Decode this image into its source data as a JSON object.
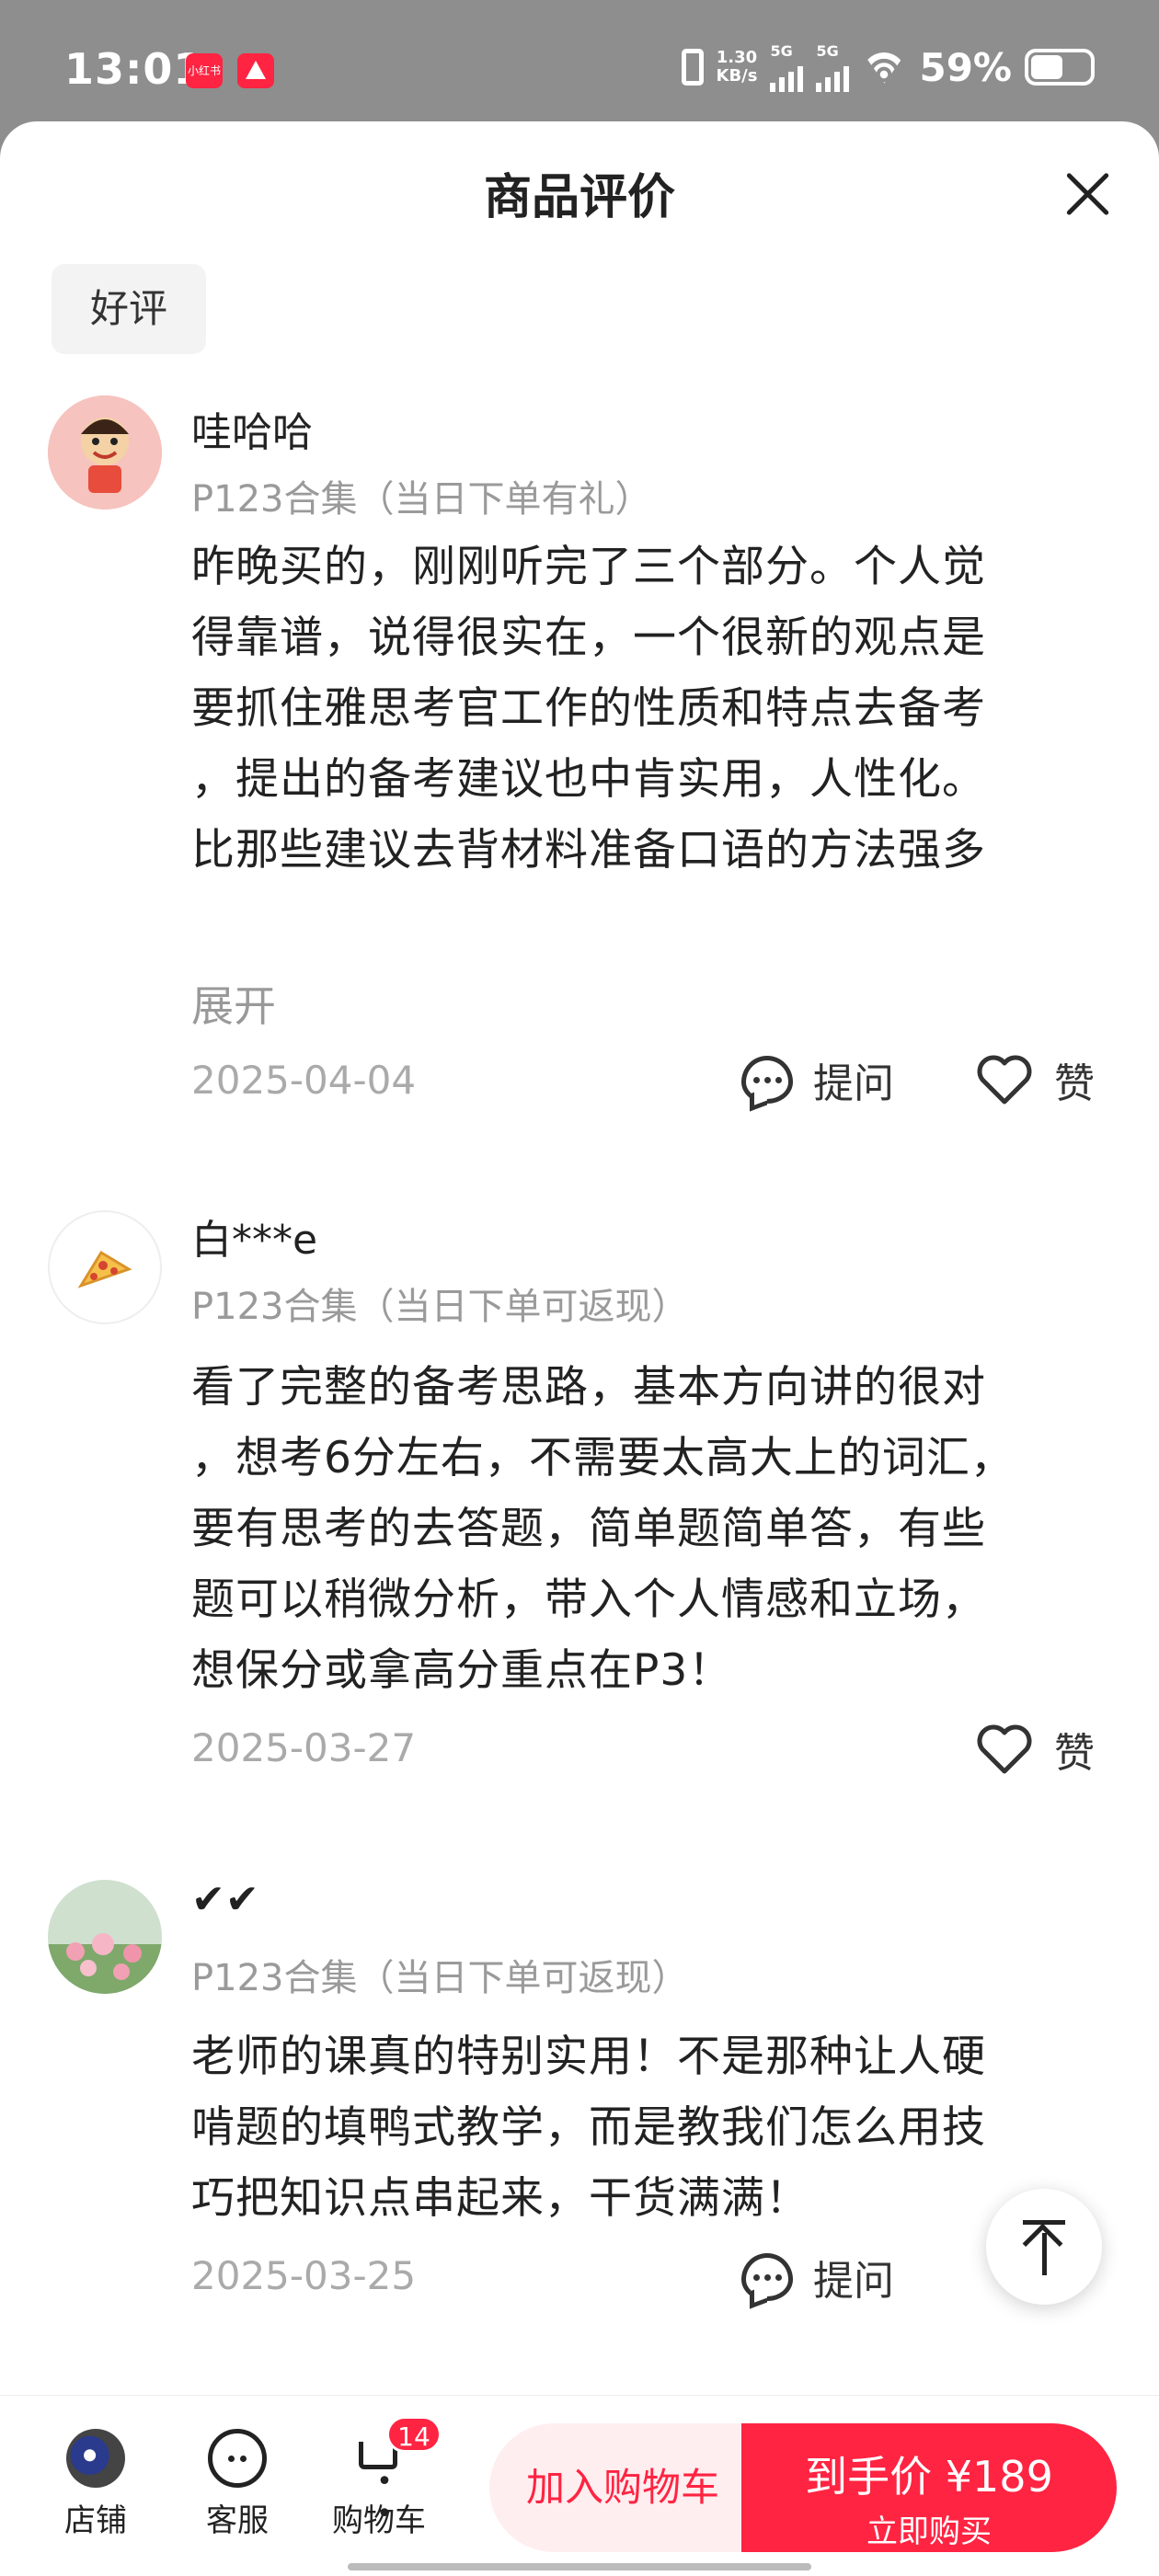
{
  "status_bar": {
    "time": "13:01",
    "app_badge_1": "小红书",
    "net_speed_top": "1.30",
    "net_speed_bottom": "KB/s",
    "sig1": "5G",
    "sig2": "5G",
    "battery": "59%"
  },
  "sheet": {
    "title": "商品评价",
    "filter_chip": "好评"
  },
  "reviews": [
    {
      "user": "哇哈哈",
      "variant": "P123合集（当日下单有礼）",
      "lines": [
        "昨晚买的，刚刚听完了三个部分。个人觉",
        "得靠谱，说得很实在，一个很新的观点是",
        "要抓住雅思考官工作的性质和特点去备考",
        "，提出的备考建议也中肯实用，人性化。",
        "比那些建议去背材料准备口语的方法强多"
      ],
      "expand": "展开",
      "date": "2025-04-04",
      "ask": "提问",
      "like": "赞"
    },
    {
      "user": "白***e",
      "variant": "P123合集（当日下单可返现）",
      "lines": [
        "看了完整的备考思路，基本方向讲的很对",
        "，想考6分左右，不需要太高大上的词汇，",
        "要有思考的去答题，简单题简单答，有些",
        "题可以稍微分析，带入个人情感和立场，",
        "想保分或拿高分重点在P3！"
      ],
      "date": "2025-03-27",
      "like": "赞"
    },
    {
      "user": "✔✔",
      "variant": "P123合集（当日下单可返现）",
      "lines": [
        "老师的课真的特别实用！不是那种让人硬",
        "啃题的填鸭式教学，而是教我们怎么用技",
        "巧把知识点串起来，干货满满！"
      ],
      "date": "2025-03-25",
      "ask": "提问"
    }
  ],
  "bottom_bar": {
    "store": "店铺",
    "service": "客服",
    "cart": "购物车",
    "cart_count": "14",
    "add_cart": "加入购物车",
    "price": "到手价 ¥189",
    "buy_now": "立即购买"
  },
  "colors": {
    "accent": "#ff2442",
    "accent_light": "#ffeef0",
    "muted_text": "#9a9a9a"
  }
}
